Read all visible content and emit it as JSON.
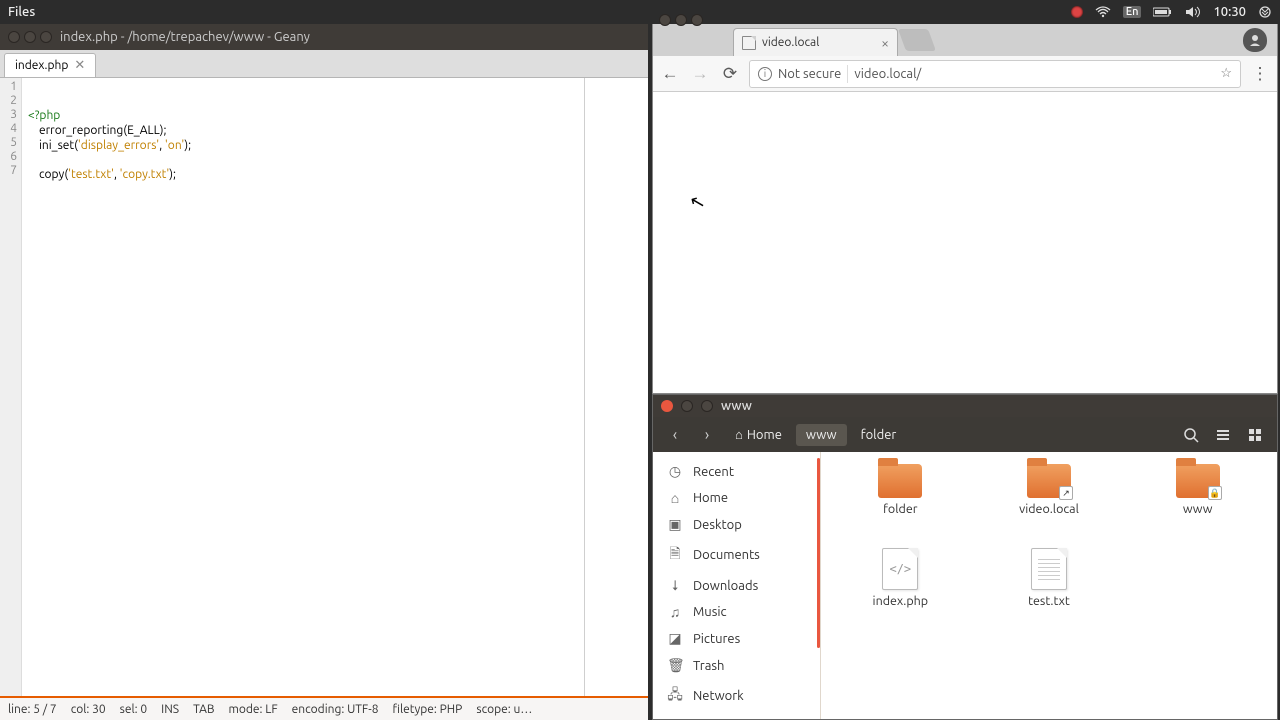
{
  "topbar": {
    "app_label": "Files",
    "lang": "En",
    "clock": "10:30"
  },
  "geany": {
    "title": "index.php - /home/trepachev/www - Geany",
    "tab": "index.php",
    "lines": [
      "1",
      "2",
      "3",
      "4",
      "5",
      "6",
      "7"
    ],
    "code": {
      "l1a": "<?php",
      "l2": "    error_reporting(E_ALL);",
      "l3a": "    ini_set(",
      "l3b": "'display_errors'",
      "l3c": ", ",
      "l3d": "'on'",
      "l3e": ");",
      "l5a": "    copy(",
      "l5b": "'test.txt'",
      "l5c": ", ",
      "l5d": "'copy.txt'",
      "l5e": ");"
    },
    "status": {
      "line": "line: 5 / 7",
      "col": "col: 30",
      "sel": "sel: 0",
      "ins": "INS",
      "tab": "TAB",
      "mode": "mode: LF",
      "enc": "encoding: UTF-8",
      "ft": "filetype: PHP",
      "scope": "scope: u…"
    }
  },
  "chrome": {
    "tab_title": "video.local",
    "security": "Not secure",
    "url": "video.local/"
  },
  "files": {
    "title": "www",
    "crumbs": {
      "home": "Home",
      "www": "www",
      "folder": "folder"
    },
    "sidebar": [
      "Recent",
      "Home",
      "Desktop",
      "Documents",
      "Downloads",
      "Music",
      "Pictures",
      "Trash",
      "Network"
    ],
    "items": {
      "folder": "folder",
      "videolocal": "video.local",
      "www": "www",
      "index": "index.php",
      "test": "test.txt"
    }
  }
}
